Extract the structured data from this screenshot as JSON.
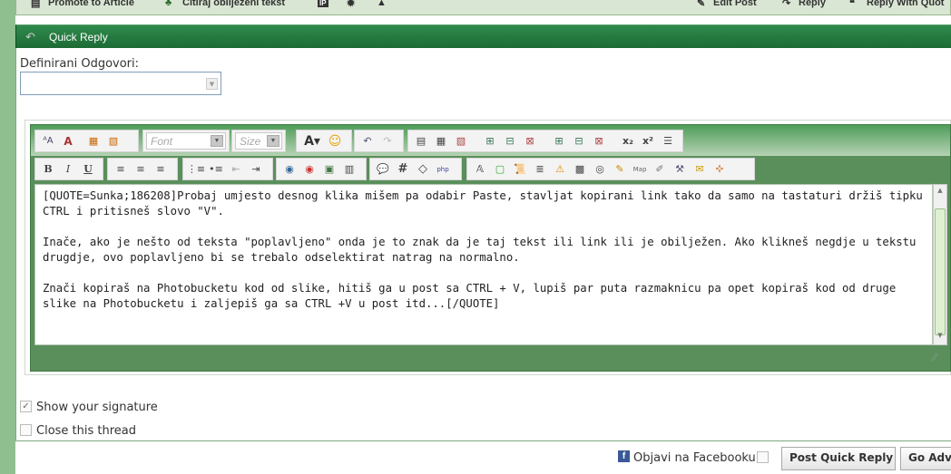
{
  "top_toolbar": {
    "promote": "Promote to Article",
    "citiraj": "Citiraj obilježeni tekst",
    "ip_badge": "IP",
    "edit_post": "Edit Post",
    "reply": "Reply",
    "reply_with_quote": "Reply With Quot"
  },
  "quick_reply": {
    "title": "Quick Reply",
    "definirani_label": "Definirani Odgovori:",
    "definirani_value": ""
  },
  "editor": {
    "font_placeholder": "Font",
    "size_placeholder": "Size",
    "content_p1": "[QUOTE=Sunka;186208]Probaj umjesto desnog klika mišem pa odabir Paste, stavljat kopirani link tako da samo na tastaturi držiš tipku CTRL i pritisneš slovo \"V\".",
    "content_p2": "Inače, ako je nešto od teksta \"poplavljeno\" onda je to znak da je taj tekst ili link ili je obilježen. Ako klikneš negdje u tekstu drugdje, ovo poplavljeno bi se trebalo odselektirat natrag na normalno.",
    "content_p3": "Znači kopiraš na Photobucketu kod od slike, hitiš ga u post sa CTRL + V, lupiš par puta razmaknicu pa opet kopiraš kod od druge slike na Photobucketu i zaljepiš ga sa CTRL +V u post itd...[/QUOTE]"
  },
  "options": {
    "show_signature": "Show your signature",
    "show_signature_checked": true,
    "close_thread": "Close this thread",
    "close_thread_checked": false
  },
  "footer": {
    "facebook_label": "Objavi na Facebooku",
    "facebook_checked": false,
    "post_quick_reply": "Post Quick Reply",
    "go_advanced": "Go Adv"
  },
  "colors": {
    "header_green": "#1d6b35",
    "editor_green": "#5a8f5c",
    "page_bg": "#8fbf8f"
  }
}
